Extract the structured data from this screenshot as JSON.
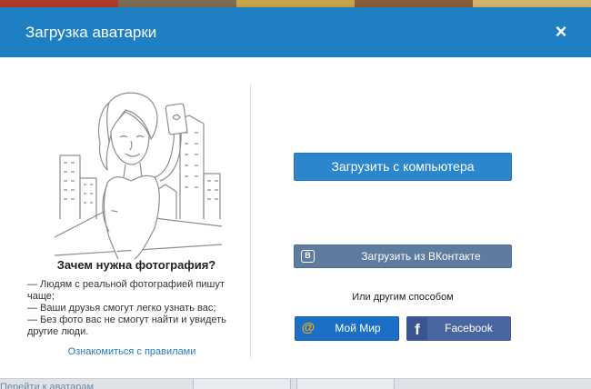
{
  "dialog": {
    "title": "Загрузка аватарки",
    "close_glyph": "×"
  },
  "info": {
    "heading": "Зачем нужна фотография?",
    "reasons": [
      "— Людям с реальной фотографией пишут чаще;",
      "— Ваши друзья смогут легко узнать вас;",
      "— Без фото вас не смогут найти и увидеть другие люди."
    ],
    "rules_link": "Ознакомиться с правилами"
  },
  "actions": {
    "upload_computer": "Загрузить с компьютера",
    "upload_vk": "Загрузить из ВКонтакте",
    "vk_icon_letter": "B",
    "other_ways": "Или другим способом",
    "moy_mir": "Мой Мир",
    "moy_mir_icon": "@",
    "facebook": "Facebook",
    "facebook_icon": "f"
  },
  "background": {
    "bottom_link": "Перейти к аватарам"
  },
  "icons": {
    "close": "close-icon",
    "vk": "vk-logo-icon",
    "moy_mir": "moy-mir-at-icon",
    "facebook": "facebook-logo-icon"
  },
  "colors": {
    "header": "#1e7fc3",
    "primary_button": "#2b86cb",
    "vk_button": "#5e7ba0",
    "moy_mir_button": "#1b70c6",
    "facebook_button": "#4a66a0",
    "link": "#2a7ab8"
  }
}
